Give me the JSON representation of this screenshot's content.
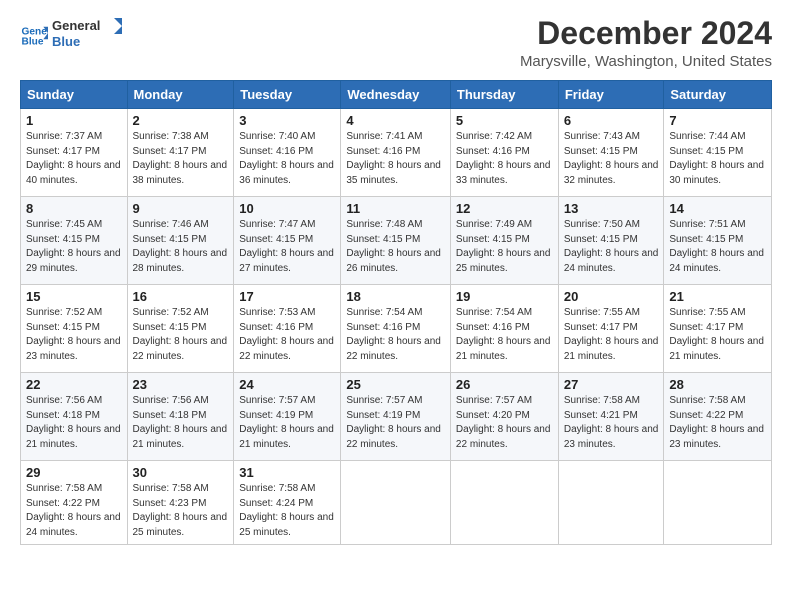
{
  "header": {
    "logo_line1": "General",
    "logo_line2": "Blue",
    "month": "December 2024",
    "location": "Marysville, Washington, United States"
  },
  "weekdays": [
    "Sunday",
    "Monday",
    "Tuesday",
    "Wednesday",
    "Thursday",
    "Friday",
    "Saturday"
  ],
  "weeks": [
    [
      {
        "day": "1",
        "rise": "7:37 AM",
        "set": "4:17 PM",
        "daylight": "8 hours and 40 minutes."
      },
      {
        "day": "2",
        "rise": "7:38 AM",
        "set": "4:17 PM",
        "daylight": "8 hours and 38 minutes."
      },
      {
        "day": "3",
        "rise": "7:40 AM",
        "set": "4:16 PM",
        "daylight": "8 hours and 36 minutes."
      },
      {
        "day": "4",
        "rise": "7:41 AM",
        "set": "4:16 PM",
        "daylight": "8 hours and 35 minutes."
      },
      {
        "day": "5",
        "rise": "7:42 AM",
        "set": "4:16 PM",
        "daylight": "8 hours and 33 minutes."
      },
      {
        "day": "6",
        "rise": "7:43 AM",
        "set": "4:15 PM",
        "daylight": "8 hours and 32 minutes."
      },
      {
        "day": "7",
        "rise": "7:44 AM",
        "set": "4:15 PM",
        "daylight": "8 hours and 30 minutes."
      }
    ],
    [
      {
        "day": "8",
        "rise": "7:45 AM",
        "set": "4:15 PM",
        "daylight": "8 hours and 29 minutes."
      },
      {
        "day": "9",
        "rise": "7:46 AM",
        "set": "4:15 PM",
        "daylight": "8 hours and 28 minutes."
      },
      {
        "day": "10",
        "rise": "7:47 AM",
        "set": "4:15 PM",
        "daylight": "8 hours and 27 minutes."
      },
      {
        "day": "11",
        "rise": "7:48 AM",
        "set": "4:15 PM",
        "daylight": "8 hours and 26 minutes."
      },
      {
        "day": "12",
        "rise": "7:49 AM",
        "set": "4:15 PM",
        "daylight": "8 hours and 25 minutes."
      },
      {
        "day": "13",
        "rise": "7:50 AM",
        "set": "4:15 PM",
        "daylight": "8 hours and 24 minutes."
      },
      {
        "day": "14",
        "rise": "7:51 AM",
        "set": "4:15 PM",
        "daylight": "8 hours and 24 minutes."
      }
    ],
    [
      {
        "day": "15",
        "rise": "7:52 AM",
        "set": "4:15 PM",
        "daylight": "8 hours and 23 minutes."
      },
      {
        "day": "16",
        "rise": "7:52 AM",
        "set": "4:15 PM",
        "daylight": "8 hours and 22 minutes."
      },
      {
        "day": "17",
        "rise": "7:53 AM",
        "set": "4:16 PM",
        "daylight": "8 hours and 22 minutes."
      },
      {
        "day": "18",
        "rise": "7:54 AM",
        "set": "4:16 PM",
        "daylight": "8 hours and 22 minutes."
      },
      {
        "day": "19",
        "rise": "7:54 AM",
        "set": "4:16 PM",
        "daylight": "8 hours and 21 minutes."
      },
      {
        "day": "20",
        "rise": "7:55 AM",
        "set": "4:17 PM",
        "daylight": "8 hours and 21 minutes."
      },
      {
        "day": "21",
        "rise": "7:55 AM",
        "set": "4:17 PM",
        "daylight": "8 hours and 21 minutes."
      }
    ],
    [
      {
        "day": "22",
        "rise": "7:56 AM",
        "set": "4:18 PM",
        "daylight": "8 hours and 21 minutes."
      },
      {
        "day": "23",
        "rise": "7:56 AM",
        "set": "4:18 PM",
        "daylight": "8 hours and 21 minutes."
      },
      {
        "day": "24",
        "rise": "7:57 AM",
        "set": "4:19 PM",
        "daylight": "8 hours and 21 minutes."
      },
      {
        "day": "25",
        "rise": "7:57 AM",
        "set": "4:19 PM",
        "daylight": "8 hours and 22 minutes."
      },
      {
        "day": "26",
        "rise": "7:57 AM",
        "set": "4:20 PM",
        "daylight": "8 hours and 22 minutes."
      },
      {
        "day": "27",
        "rise": "7:58 AM",
        "set": "4:21 PM",
        "daylight": "8 hours and 23 minutes."
      },
      {
        "day": "28",
        "rise": "7:58 AM",
        "set": "4:22 PM",
        "daylight": "8 hours and 23 minutes."
      }
    ],
    [
      {
        "day": "29",
        "rise": "7:58 AM",
        "set": "4:22 PM",
        "daylight": "8 hours and 24 minutes."
      },
      {
        "day": "30",
        "rise": "7:58 AM",
        "set": "4:23 PM",
        "daylight": "8 hours and 25 minutes."
      },
      {
        "day": "31",
        "rise": "7:58 AM",
        "set": "4:24 PM",
        "daylight": "8 hours and 25 minutes."
      },
      null,
      null,
      null,
      null
    ]
  ]
}
